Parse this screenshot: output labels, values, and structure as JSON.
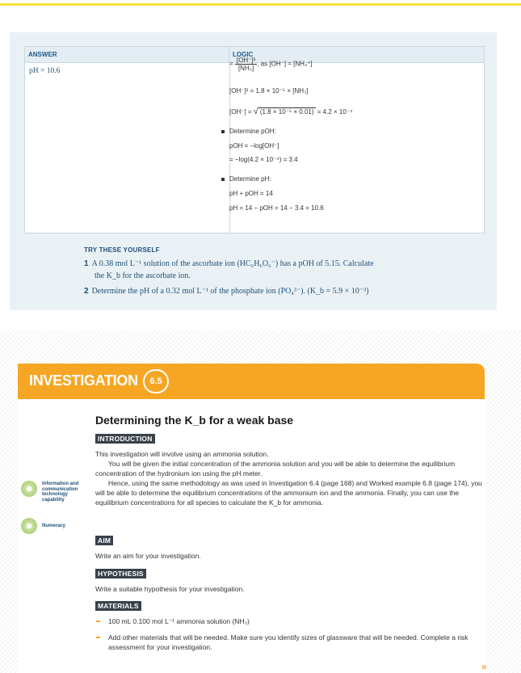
{
  "worked_example": {
    "answer_header": "ANSWER",
    "logic_header": "LOGIC",
    "answer": "pH = 10.6",
    "logic_lines": {
      "frac_num": "[OH⁻]²",
      "frac_den": "[NH₃]",
      "frac_tail": ", as [OH⁻] = [NH₄⁺]",
      "line2": "[OH⁻]² = 1.8 × 10⁻⁵ × [NH₃]",
      "line3_pre": "[OH⁻] =",
      "line3_root": "(1.8 × 10⁻⁵ × 0.01)",
      "line3_post": "= 4.2 × 10⁻⁴",
      "bullet1": "Determine pOH:",
      "line4": "pOH = −log[OH⁻]",
      "line5": "= −log(4.2 × 10⁻⁴) = 3.4",
      "bullet2": "Determine pH:",
      "line6": "pH + pOH = 14",
      "line7": "pH = 14 − pOH = 14 − 3.4 = 10.6"
    }
  },
  "try_yourself": {
    "title": "TRY THESE YOURSELF",
    "q1_num": "1",
    "q1_line1": "A 0.38 mol L⁻¹ solution of the ascorbate ion (HC₆H₆O₆⁻) has a pOH of 5.15. Calculate",
    "q1_line2": "the K_b for the ascorbate ion.",
    "q2_num": "2",
    "q2_line1": "Determine the pH of a 0.32 mol L⁻¹ of the phosphate ion (PO₄³⁻). (K_b = 5.9 × 10⁻³)"
  },
  "investigation": {
    "banner": "INVESTIGATION",
    "number": "6.5",
    "heading": "Determining the K_b for a weak base",
    "introduction_label": "INTRODUCTION",
    "intro_p1": "This investigation will involve using an ammonia solution.",
    "intro_p2": "You will be given the initial concentration of the ammonia solution and you will be able to determine the equilibrium concentration of the hydronium ion using the pH meter.",
    "intro_p3": "Hence, using the same methodology as was used in Investigation 6.4 (page 168) and Worked example 6.8 (page 174), you will be able to determine the equilibrium concentrations of the ammonium ion and the ammonia. Finally, you can use the equilibrium concentrations for all species to calculate the K_b for ammonia.",
    "capability1": "Information and communication technology capability",
    "capability2": "Numeracy",
    "aim_label": "AIM",
    "aim_text": "Write an aim for your investigation.",
    "hypothesis_label": "HYPOTHESIS",
    "hypothesis_text": "Write a suitable hypothesis for your investigation.",
    "materials_label": "MATERIALS",
    "materials": [
      "100 mL 0.100 mol L⁻¹ ammonia solution (NH₃)",
      "Add other materials that will be needed. Make sure you identify sizes of glassware that will be needed. Complete a risk assessment for your investigation."
    ],
    "continue_mark": "»"
  },
  "colors": {
    "accent": "#f6a623",
    "heading_blue": "#1e4f7a",
    "panel": "#eaf1f5"
  }
}
